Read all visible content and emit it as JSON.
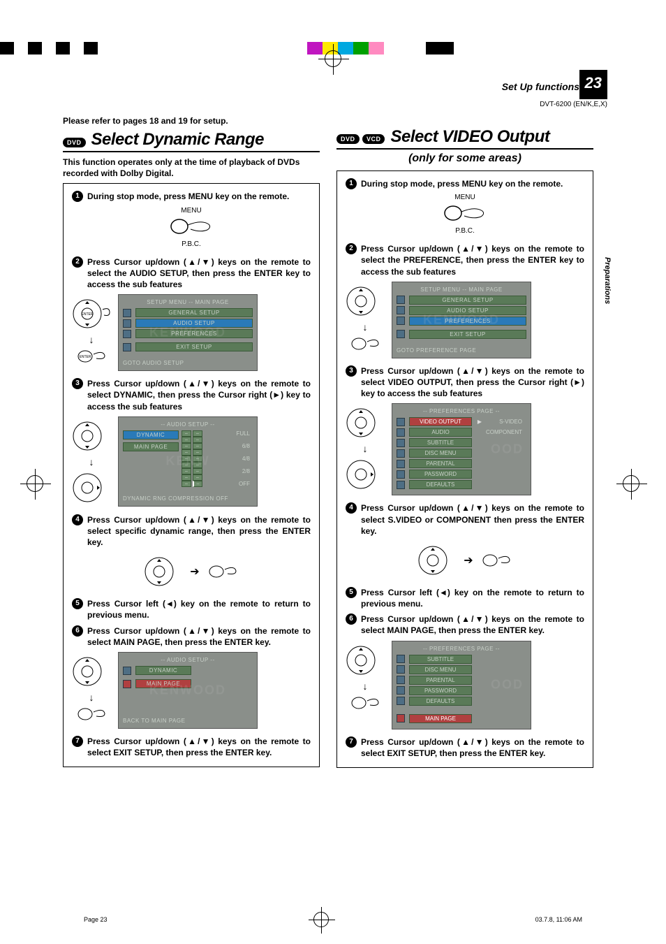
{
  "header": {
    "section": "Set Up functions",
    "page_number": "23",
    "model": "DVT-6200 (EN/K,E,X)",
    "side_tab": "Preparations"
  },
  "left": {
    "ref_note": "Please refer to pages 18 and 19 for setup.",
    "badge": "DVD",
    "title": "Select Dynamic Range",
    "intro": "This function operates only at the time of playback of DVDs recorded with Dolby Digital.",
    "steps": {
      "s1": "During stop mode, press MENU key on the remote.",
      "s2": "Press Cursor up/down (▲/▼) keys on the remote to select the AUDIO SETUP, then press the ENTER key to access the sub features",
      "s3": "Press Cursor up/down (▲/▼) keys on the remote to select DYNAMIC, then press the Cursor right (►) key to access the sub features",
      "s4": "Press Cursor up/down (▲/▼) keys on the remote to select specific dynamic range, then press the ENTER key.",
      "s5": "Press Cursor left (◄) key on the remote to return to previous menu.",
      "s6": "Press Cursor up/down (▲/▼) keys on the remote to select MAIN PAGE, then press the ENTER key.",
      "s7": "Press Cursor up/down (▲/▼) keys on the remote to select EXIT SETUP, then press the ENTER key."
    },
    "menu_label": "MENU",
    "menu_sublabel": "P.B.C.",
    "screen1": {
      "title": "SETUP MENU -- MAIN PAGE",
      "items": [
        "GENERAL SETUP",
        "AUDIO SETUP",
        "PREFERENCES",
        "EXIT SETUP"
      ],
      "footer": "GOTO AUDIO SETUP"
    },
    "screen2": {
      "title": "-- AUDIO SETUP --",
      "left_items": [
        "DYNAMIC",
        "MAIN PAGE"
      ],
      "opts": [
        "FULL",
        "",
        "6/8",
        "",
        "4/8",
        "",
        "2/8",
        "",
        "OFF"
      ],
      "footer": "DYNAMIC RNG COMPRESSION OFF"
    },
    "screen3": {
      "title": "-- AUDIO SETUP --",
      "left_items": [
        "DYNAMIC",
        "MAIN PAGE"
      ],
      "footer": "BACK TO MAIN PAGE"
    }
  },
  "right": {
    "badges": [
      "DVD",
      "VCD"
    ],
    "title": "Select VIDEO Output",
    "subtitle": "(only for some areas)",
    "steps": {
      "s1": "During stop mode, press MENU key on the remote.",
      "s2": "Press Cursor up/down (▲/▼) keys on the remote to select the PREFERENCE, then press the ENTER key to access the sub features",
      "s3": "Press Cursor up/down (▲/▼) keys on the remote to select VIDEO OUTPUT, then press the Cursor right (►) key to access the sub features",
      "s4": "Press Cursor up/down (▲/▼) keys on the remote to select S.VIDEO or COMPONENT then press the ENTER key.",
      "s5": "Press Cursor left (◄) key on the remote to return to previous menu.",
      "s6": "Press Cursor up/down (▲/▼) keys on the remote to select MAIN PAGE, then press the ENTER key.",
      "s7": "Press Cursor up/down (▲/▼) keys on the remote to select EXIT SETUP, then press the ENTER key."
    },
    "menu_label": "MENU",
    "menu_sublabel": "P.B.C.",
    "screen1": {
      "title": "SETUP MENU -- MAIN PAGE",
      "items": [
        "GENERAL SETUP",
        "AUDIO SETUP",
        "PREFERENCES",
        "EXIT SETUP"
      ],
      "footer": "GOTO PREFERENCE PAGE"
    },
    "screen2": {
      "title": "-- PREFERENCES PAGE --",
      "items": [
        "VIDEO OUTPUT",
        "AUDIO",
        "SUBTITLE",
        "DISC MENU",
        "PARENTAL",
        "PASSWORD",
        "DEFAULTS"
      ],
      "opts": [
        "S-VIDEO",
        "COMPONENT"
      ]
    },
    "screen3": {
      "title": "-- PREFERENCES PAGE --",
      "items": [
        "SUBTITLE",
        "DISC MENU",
        "PARENTAL",
        "PASSWORD",
        "DEFAULTS",
        "MAIN PAGE"
      ]
    }
  },
  "footer": {
    "page": "Page 23",
    "timestamp": "03.7.8, 11:06 AM"
  },
  "color_bars": [
    "#000",
    "#000",
    "#000",
    "#000",
    "#000",
    "#fff",
    "#fff",
    "#fff",
    "#fff",
    "#fff",
    "#fff",
    "#c016c0",
    "#ffea00",
    "#00a8e0",
    "#00a000",
    "#ff8ac0",
    "#fff",
    "#000"
  ]
}
